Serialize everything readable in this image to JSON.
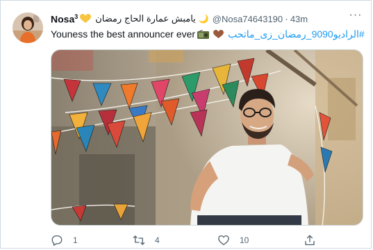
{
  "tweet": {
    "author_name": "Nosa",
    "author_name_sup": "3",
    "arabic_name": "يامبش عمارة الحاج رمضان",
    "moon_glyph": "🌙",
    "handle": "@Nosa74643190",
    "separator": "·",
    "time": "43m",
    "more_glyph": "···",
    "text": "Youness the best announcer ever",
    "hashtag": "#الراديو9090_رمضان_زى_ماتحب",
    "counts": {
      "replies": "1",
      "retweets": "4",
      "likes": "10"
    }
  },
  "icons": [
    "yellow-heart-icon",
    "crescent-moon-icon",
    "more-icon",
    "radio-icon",
    "brown-heart-icon",
    "reply-icon",
    "retweet-icon",
    "like-icon",
    "share-icon"
  ],
  "colors": {
    "accent": "#1d9bf0",
    "secondary_text": "#536471",
    "border": "#cfd9de",
    "heart_yellow": "#f8c540",
    "heart_brown": "#9b5a3c"
  }
}
